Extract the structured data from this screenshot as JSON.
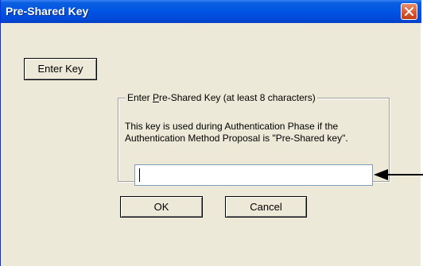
{
  "window": {
    "title": "Pre-Shared Key",
    "close_icon": "close-icon"
  },
  "buttons": {
    "enter_key": "Enter Key",
    "ok": "OK",
    "cancel": "Cancel"
  },
  "group": {
    "legend_prefix": "Enter ",
    "legend_mnemonic": "P",
    "legend_suffix": "re-Shared Key (at least 8 characters)",
    "description_line1": "This key is used during Authentication Phase if the",
    "description_line2": "Authentication Method Proposal is \"Pre-Shared key\"."
  },
  "key_input": {
    "value": ""
  },
  "colors": {
    "title_bar": "#0054e3",
    "dialog_bg": "#ece9d8",
    "close_button": "#d9542f"
  }
}
